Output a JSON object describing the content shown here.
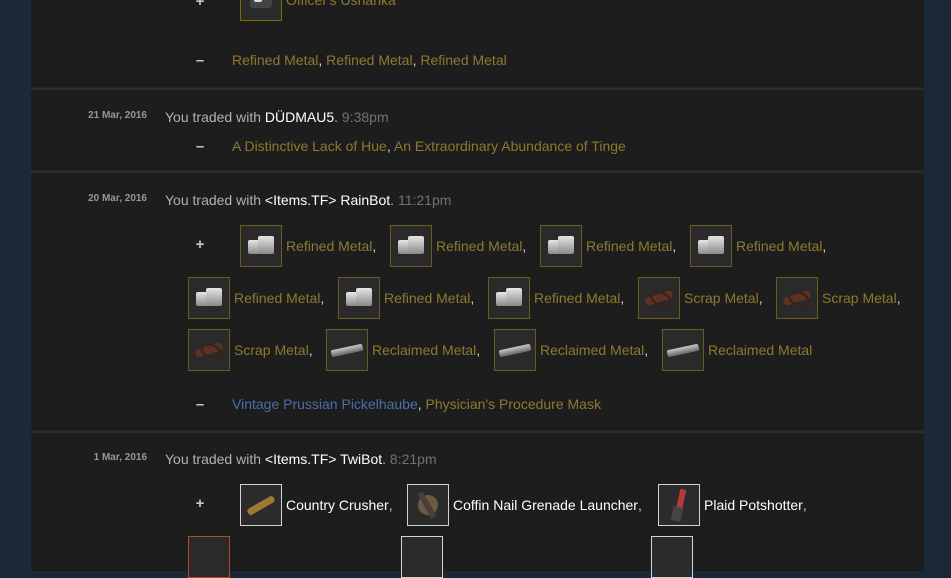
{
  "trades": [
    {
      "given_item": {
        "name": "Officer's Ushanka",
        "icon": "ushanka-icon"
      },
      "received": [
        "Refined Metal",
        "Refined Metal",
        "Refined Metal"
      ]
    },
    {
      "date": "21 Mar, 2016",
      "prefix": "You traded with",
      "partner": "DÜDMAU5",
      "time": "9:38pm",
      "received": [
        "A Distinctive Lack of Hue",
        "An Extraordinary Abundance of Tinge"
      ]
    },
    {
      "date": "20 Mar, 2016",
      "prefix": "You traded with",
      "partner": "<Items.TF> RainBot",
      "time": "11:21pm",
      "given": [
        {
          "name": "Refined Metal",
          "icon": "refined-metal-icon"
        },
        {
          "name": "Refined Metal",
          "icon": "refined-metal-icon"
        },
        {
          "name": "Refined Metal",
          "icon": "refined-metal-icon"
        },
        {
          "name": "Refined Metal",
          "icon": "refined-metal-icon"
        },
        {
          "name": "Refined Metal",
          "icon": "refined-metal-icon"
        },
        {
          "name": "Refined Metal",
          "icon": "refined-metal-icon"
        },
        {
          "name": "Refined Metal",
          "icon": "refined-metal-icon"
        },
        {
          "name": "Scrap Metal",
          "icon": "scrap-metal-icon"
        },
        {
          "name": "Scrap Metal",
          "icon": "scrap-metal-icon"
        },
        {
          "name": "Scrap Metal",
          "icon": "scrap-metal-icon"
        },
        {
          "name": "Reclaimed Metal",
          "icon": "reclaimed-metal-icon"
        },
        {
          "name": "Reclaimed Metal",
          "icon": "reclaimed-metal-icon"
        },
        {
          "name": "Reclaimed Metal",
          "icon": "reclaimed-metal-icon"
        }
      ],
      "received": [
        "Vintage Prussian Pickelhaube",
        "Physician's Procedure Mask"
      ]
    },
    {
      "date": "1 Mar, 2016",
      "prefix": "You traded with",
      "partner": "<Items.TF> TwiBot",
      "time": "8:21pm",
      "given": [
        {
          "name": "Country Crusher",
          "icon": "country-crusher-icon"
        },
        {
          "name": "Coffin Nail Grenade Launcher",
          "icon": "grenade-launcher-icon"
        },
        {
          "name": "Plaid Potshotter",
          "icon": "plaid-potshotter-icon"
        }
      ]
    }
  ],
  "signs": {
    "plus": "+",
    "minus": "–"
  },
  "separator": ",",
  "colors": {
    "unique_quality": "#8d7a2f",
    "vintage_quality": "#476291",
    "partner_name": "#ffffff",
    "timestamp": "#6e7378"
  }
}
